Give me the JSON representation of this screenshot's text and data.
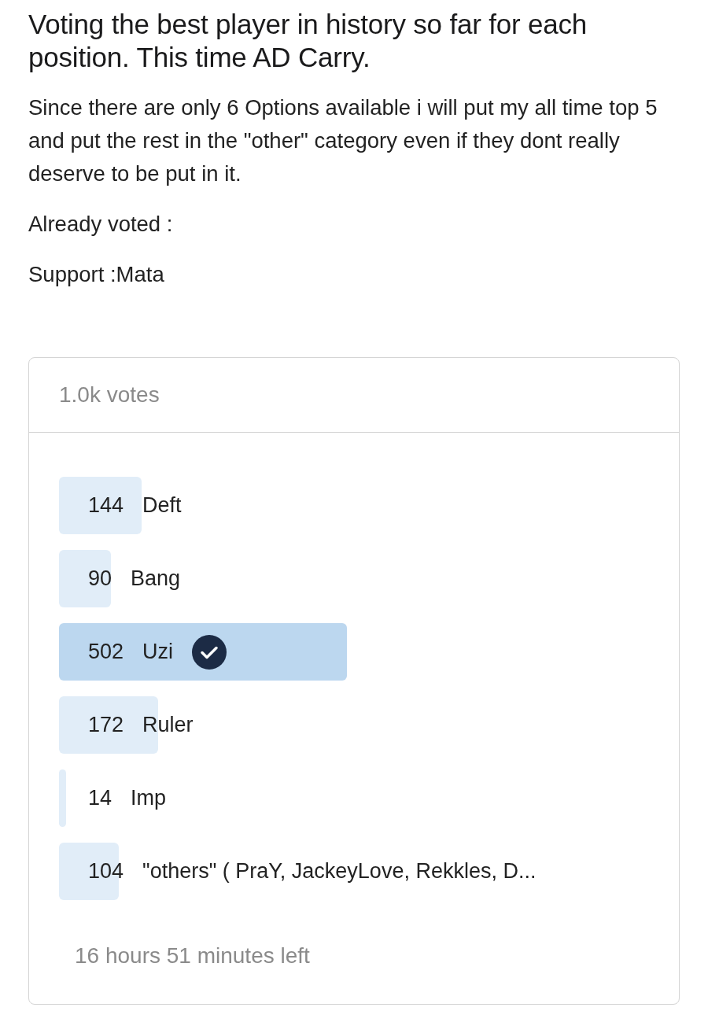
{
  "title": "Voting the best player in history so far for each position. This time AD Carry.",
  "paragraphs": [
    "Since there are only 6 Options available i will put my all time top 5 and put the rest in the \"other\" category even if they dont really deserve to be put in it.",
    "Already voted :",
    "Support :Mata"
  ],
  "poll": {
    "votes": "1.0k votes",
    "options": [
      {
        "count": "144",
        "label": "Deft",
        "level": 0.14,
        "selected": false
      },
      {
        "count": "90",
        "label": "Bang",
        "level": 0.088,
        "selected": false
      },
      {
        "count": "502",
        "label": "Uzi",
        "level": 0.489,
        "selected": true
      },
      {
        "count": "172",
        "label": "Ruler",
        "level": 0.168,
        "selected": false
      },
      {
        "count": "14",
        "label": "Imp",
        "level": 0.012,
        "selected": false
      },
      {
        "count": "104",
        "label": "\"others\" ( PraY, JackeyLove, Rekkles, D...",
        "level": 0.101,
        "selected": false
      }
    ],
    "time_left": "16 hours 51 minutes left"
  }
}
